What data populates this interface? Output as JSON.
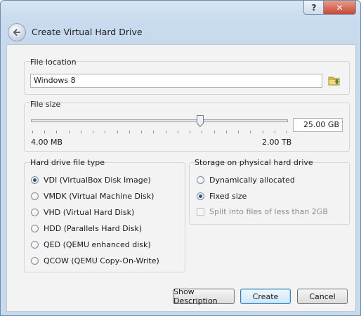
{
  "titlebar": {
    "help_label": "?",
    "close_label": "✕"
  },
  "header": {
    "title": "Create Virtual Hard Drive",
    "back_icon": "back-arrow-icon"
  },
  "file_location": {
    "label": "File location",
    "value": "Windows 8",
    "button_icon": "folder-browse-icon"
  },
  "file_size": {
    "label": "File size",
    "min_label": "4.00 MB",
    "max_label": "2.00 TB",
    "value": "25.00 GB",
    "slider_fraction": 0.65
  },
  "disk_type": {
    "label": "Hard drive file type",
    "options": [
      {
        "label": "VDI (VirtualBox Disk Image)",
        "selected": true
      },
      {
        "label": "VMDK (Virtual Machine Disk)",
        "selected": false
      },
      {
        "label": "VHD (Virtual Hard Disk)",
        "selected": false
      },
      {
        "label": "HDD (Parallels Hard Disk)",
        "selected": false
      },
      {
        "label": "QED (QEMU enhanced disk)",
        "selected": false
      },
      {
        "label": "QCOW (QEMU Copy-On-Write)",
        "selected": false
      }
    ]
  },
  "storage": {
    "label": "Storage on physical hard drive",
    "options": [
      {
        "label": "Dynamically allocated",
        "selected": false
      },
      {
        "label": "Fixed size",
        "selected": true
      }
    ],
    "split_label": "Split into files of less than 2GB"
  },
  "buttons": {
    "show_description": "Show Description",
    "create": "Create",
    "cancel": "Cancel"
  }
}
